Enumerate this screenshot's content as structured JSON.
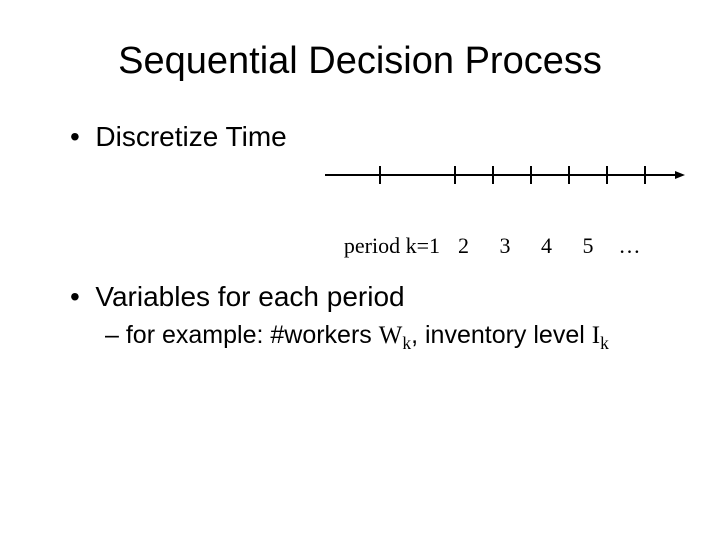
{
  "title": "Sequential Decision Process",
  "bullets": {
    "discretize": "Discretize Time",
    "variables": "Variables for each period",
    "example_prefix": "for example: #workers ",
    "example_w": "W",
    "example_wk": "k",
    "example_mid": ", inventory level ",
    "example_i": "I",
    "example_ik": "k"
  },
  "timeline": {
    "period_label": "period k=1",
    "t2": "2",
    "t3": "3",
    "t4": "4",
    "t5": "5",
    "dots": "…"
  }
}
